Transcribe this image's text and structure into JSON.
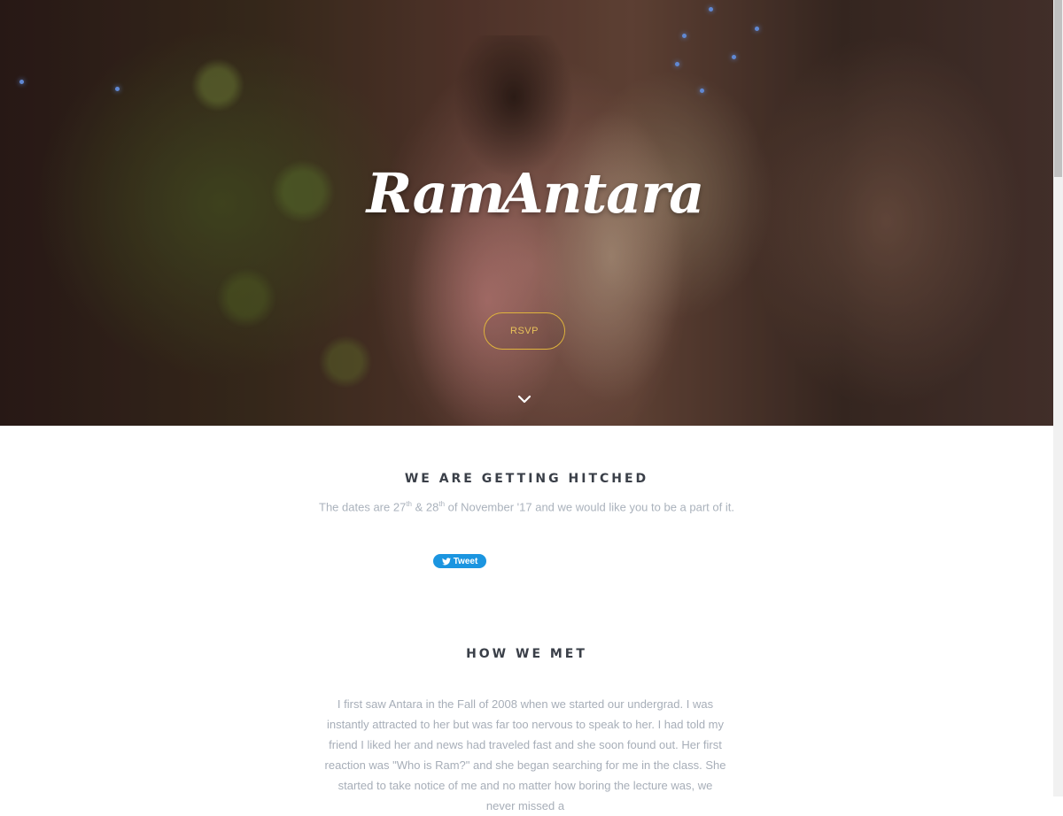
{
  "hero": {
    "title_left": "Ram",
    "title_right": "Antara",
    "heart_icon": "heart-icon",
    "heart_color": "#e8141b",
    "rsvp_label": "RSVP",
    "rsvp_color": "#e0b43c",
    "scroll_icon": "chevron-down-icon"
  },
  "hitched": {
    "title": "WE ARE GETTING HITCHED",
    "subtitle_prefix": "The dates are 27",
    "sup1": "th",
    "mid": " & 28",
    "sup2": "th",
    "subtitle_suffix": " of November '17 and we would like you to be a part of it.",
    "tweet_label": "Tweet",
    "tweet_color": "#1b95e0"
  },
  "met": {
    "title": "HOW WE MET",
    "story": "I first saw Antara in the Fall of 2008 when we started our undergrad. I was instantly attracted to her but was far too nervous to speak to her. I had told my friend I liked her and news had traveled fast and she soon found out. Her first reaction was \"Who is Ram?\" and she began searching for me in the class. She started to take notice of me and no matter how boring the lecture was, we never missed a"
  }
}
